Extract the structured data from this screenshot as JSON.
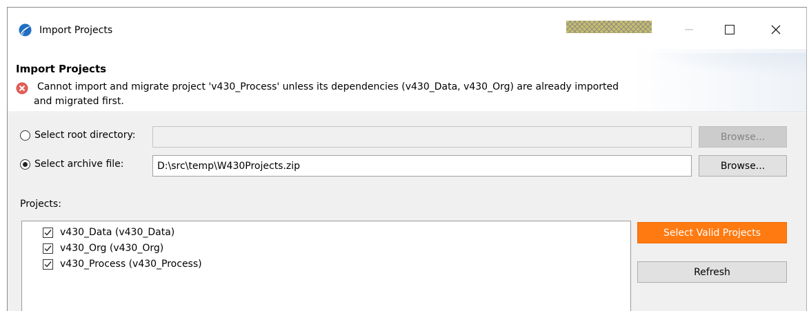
{
  "window": {
    "title": "Import Projects",
    "controls": {
      "minimize": "—",
      "maximize": "☐",
      "close": "✕"
    }
  },
  "header": {
    "heading": "Import Projects",
    "error_line1": "Cannot import and migrate project 'v430_Process' unless its dependencies (v430_Data, v430_Org) are already imported",
    "error_line2": "and migrated first."
  },
  "source": {
    "root_directory": {
      "label": "Select root directory:",
      "selected": false,
      "value": "",
      "browse_label": "Browse...",
      "enabled": false
    },
    "archive_file": {
      "label": "Select archive file:",
      "selected": true,
      "value": "D:\\src\\temp\\W430Projects.zip",
      "browse_label": "Browse...",
      "enabled": true
    }
  },
  "projects": {
    "label": "Projects:",
    "items": [
      {
        "label": "v430_Data (v430_Data)",
        "checked": true
      },
      {
        "label": "v430_Org (v430_Org)",
        "checked": true
      },
      {
        "label": "v430_Process (v430_Process)",
        "checked": true
      }
    ],
    "select_valid_label": "Select Valid Projects",
    "refresh_label": "Refresh"
  },
  "colors": {
    "accent": "#ff7a11",
    "error": "#d9534f"
  }
}
